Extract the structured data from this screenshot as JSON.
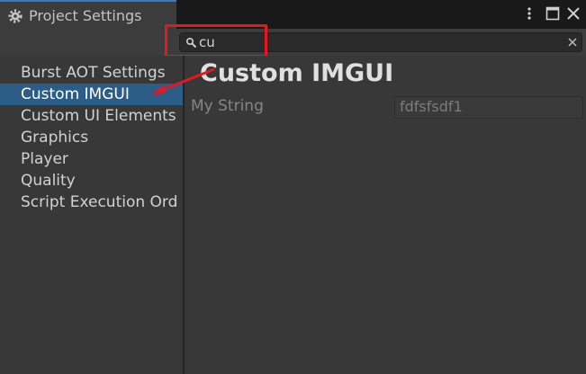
{
  "window": {
    "title": "Project Settings",
    "icons": [
      "gear-icon",
      "more-options-icon",
      "maximize-icon",
      "close-icon"
    ]
  },
  "search": {
    "value": "cu",
    "placeholder": ""
  },
  "sidebar": {
    "items": [
      {
        "label": "Burst AOT Settings",
        "selected": false
      },
      {
        "label": "Custom IMGUI",
        "selected": true
      },
      {
        "label": "Custom UI Elements",
        "selected": false
      },
      {
        "label": "Graphics",
        "selected": false
      },
      {
        "label": "Player",
        "selected": false
      },
      {
        "label": "Quality",
        "selected": false
      },
      {
        "label": "Script Execution Ord",
        "selected": false
      }
    ]
  },
  "main": {
    "title": "Custom IMGUI",
    "fields": [
      {
        "label": "My String",
        "value": "fdfsfsdf1"
      }
    ]
  },
  "colors": {
    "selection": "#2c5d87",
    "annotation": "#e8161e",
    "tab_accent": "#3a79bb",
    "background": "#383838"
  }
}
